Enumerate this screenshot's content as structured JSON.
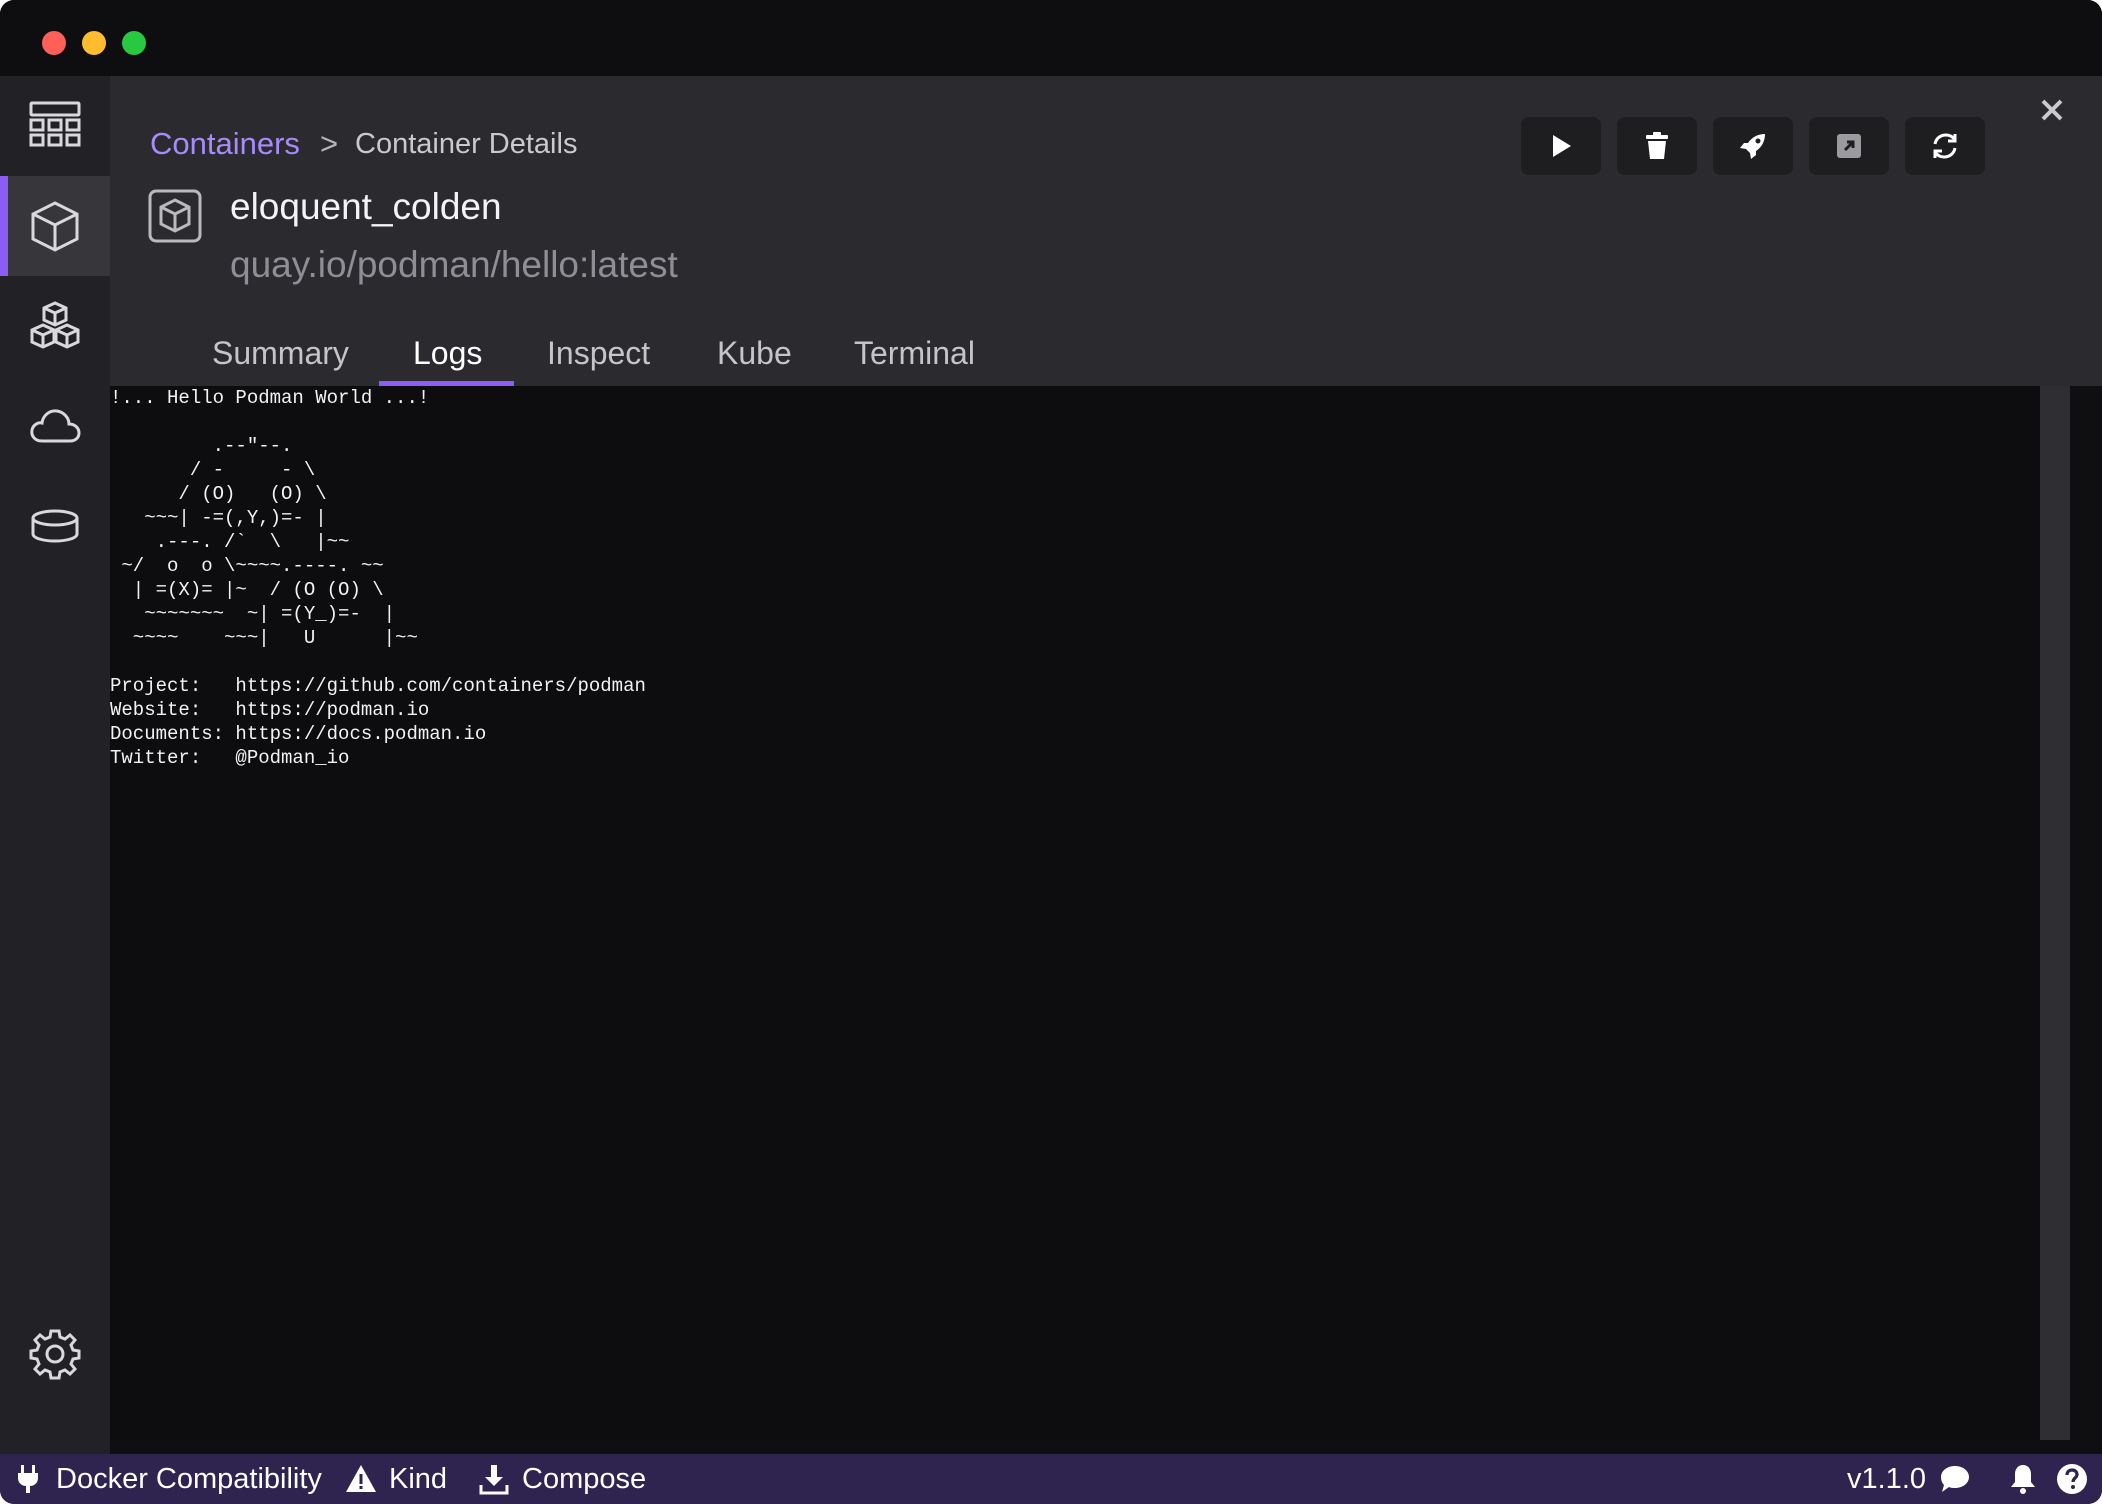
{
  "breadcrumb": {
    "parent": "Containers",
    "separator": ">",
    "current": "Container Details"
  },
  "container": {
    "name": "eloquent_colden",
    "image": "quay.io/podman/hello:latest"
  },
  "tabs": [
    {
      "label": "Summary"
    },
    {
      "label": "Logs"
    },
    {
      "label": "Inspect"
    },
    {
      "label": "Kube"
    },
    {
      "label": "Terminal"
    }
  ],
  "active_tab": "Logs",
  "actions": [
    {
      "name": "start",
      "icon": "play-icon"
    },
    {
      "name": "delete",
      "icon": "trash-icon"
    },
    {
      "name": "deploy",
      "icon": "rocket-icon"
    },
    {
      "name": "open-external",
      "icon": "external-link-icon"
    },
    {
      "name": "restart",
      "icon": "refresh-icon"
    }
  ],
  "sidebar": [
    {
      "name": "dashboard",
      "icon": "dashboard-grid-icon"
    },
    {
      "name": "containers",
      "icon": "container-cube-icon",
      "active": true
    },
    {
      "name": "pods",
      "icon": "pods-cubes-icon"
    },
    {
      "name": "images",
      "icon": "cloud-icon"
    },
    {
      "name": "volumes",
      "icon": "database-icon"
    },
    {
      "name": "settings",
      "icon": "gear-icon"
    }
  ],
  "logs": "!... Hello Podman World ...!\n\n         .--\"--.\n       / -     - \\\n      / (O)   (O) \\\n   ~~~| -=(,Y,)=- |\n    .---. /`  \\   |~~\n ~/  o  o \\~~~~.----. ~~\n  | =(X)= |~  / (O (O) \\\n   ~~~~~~~  ~| =(Y_)=-  |\n  ~~~~    ~~~|   U      |~~\n\nProject:   https://github.com/containers/podman\nWebsite:   https://podman.io\nDocuments: https://docs.podman.io\nTwitter:   @Podman_io",
  "statusbar": {
    "docker": "Docker Compatibility",
    "kind": "Kind",
    "compose": "Compose",
    "version": "v1.1.0"
  },
  "colors": {
    "accent": "#8b5cf6",
    "statusbar": "#2f2350",
    "link": "#a78bfa"
  }
}
